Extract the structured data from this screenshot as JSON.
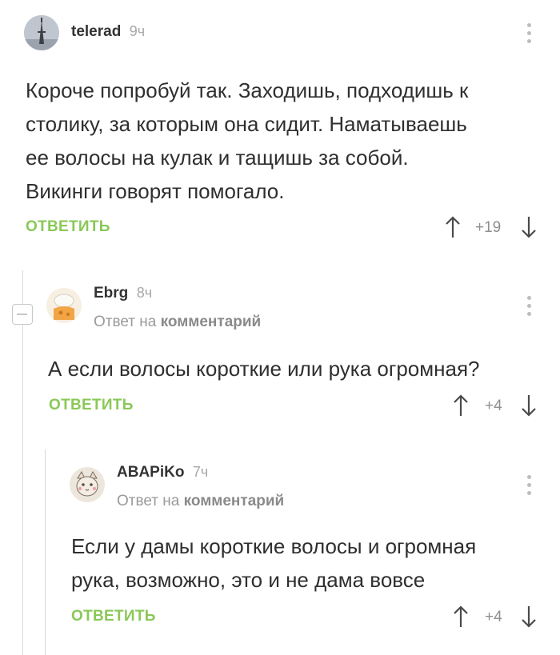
{
  "comments": [
    {
      "username": "telerad",
      "time": "9ч",
      "reply_to_prefix": "",
      "reply_to_target": "",
      "text_lines": [
        "Короче попробуй так. Заходишь, подходишь к",
        "столику, за которым она сидит. Наматываешь",
        "ее волосы на кулак и тащишь за собой.",
        "Викинги говорят помогало."
      ],
      "reply_label": "ОТВЕТИТЬ",
      "rating": "+19"
    },
    {
      "username": "Ebrg",
      "time": "8ч",
      "reply_to_prefix": "Ответ на",
      "reply_to_target": "комментарий",
      "text_lines": [
        "А если волосы короткие или рука огромная?"
      ],
      "reply_label": "ОТВЕТИТЬ",
      "rating": "+4"
    },
    {
      "username": "ABAPiKo",
      "time": "7ч",
      "reply_to_prefix": "Ответ на",
      "reply_to_target": "комментарий",
      "text_lines": [
        "Если у дамы короткие волосы и огромная",
        "рука, возможно, это и не дама вовсе"
      ],
      "reply_label": "ОТВЕТИТЬ",
      "rating": "+4"
    }
  ],
  "icons": {
    "upvote": "arrow-up-icon",
    "downvote": "arrow-down-icon",
    "menu": "more-vertical-icon",
    "collapse": "minus-icon"
  },
  "colors": {
    "accent_green": "#8ac858",
    "text": "#2f2f2f",
    "muted": "#9a9a9a",
    "thread_line": "#d9d9d9"
  }
}
